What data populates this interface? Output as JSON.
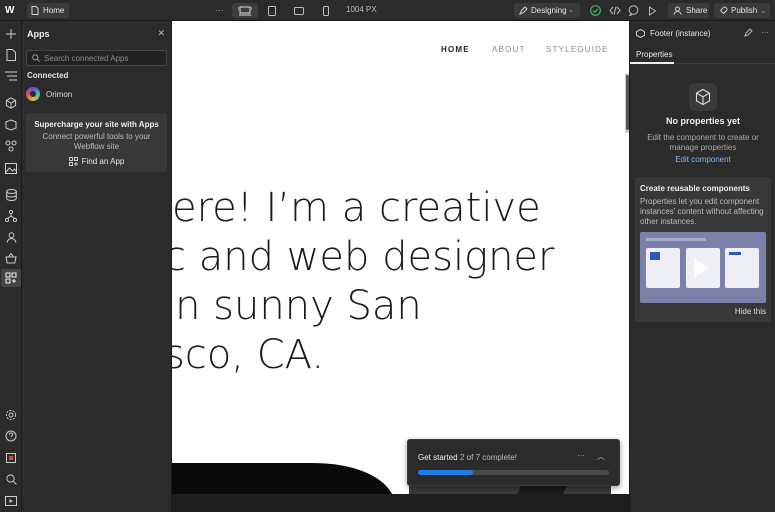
{
  "topbar": {
    "logo": "W",
    "home_label": "Home",
    "viewport_size": "1004 PX",
    "mode_label": "Designing",
    "share_label": "Share",
    "publish_label": "Publish"
  },
  "apps_panel": {
    "title": "Apps",
    "search_placeholder": "Search connected Apps",
    "connected_heading": "Connected",
    "apps": [
      {
        "name": "Orimon"
      }
    ],
    "promo": {
      "title": "Supercharge your site with Apps",
      "description": "Connect powerful tools to your Webflow site",
      "button_label": "Find an App"
    }
  },
  "canvas": {
    "nav": {
      "home": "HOME",
      "about": "ABOUT",
      "styleguide": "STYLEGUIDE"
    },
    "hero_lines": [
      "ere! I’m a creative",
      "c and web designer",
      "in sunny San",
      "sco, CA."
    ]
  },
  "get_started": {
    "title": "Get started",
    "progress_text": "2 of 7 complete!",
    "completed": 2,
    "total": 7
  },
  "right_panel": {
    "element_title": "Footer (instance)",
    "tab": "Properties",
    "empty_title": "No properties yet",
    "empty_description": "Edit the component to create or manage properties",
    "edit_component_label": "Edit component",
    "reusable": {
      "title": "Create reusable components",
      "description": "Properties let you edit component instances’ content without affecting other instances.",
      "hide_label": "Hide this"
    }
  },
  "colors": {
    "accent": "#1f7ee8",
    "panel": "#2b2b2b",
    "link": "#7fb6f5",
    "status_ok": "#3bb36b"
  }
}
